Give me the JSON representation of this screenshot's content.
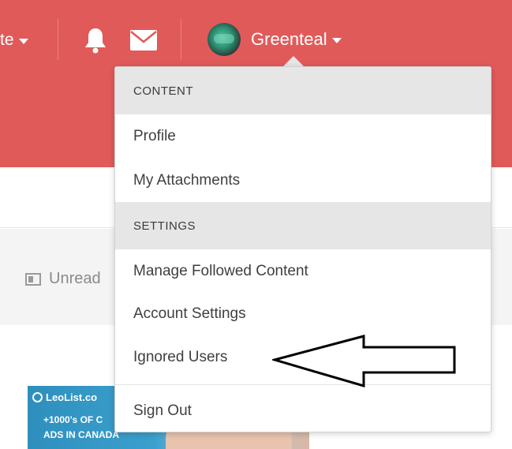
{
  "topbar": {
    "create_label": "te",
    "username": "Greenteal",
    "icons": [
      "bell-icon",
      "mail-icon",
      "avatar"
    ],
    "color": "#e15a5a"
  },
  "content": {
    "unread_label": "Unread",
    "ad": {
      "brand": "LeoList.co",
      "line1": "+1000's OF C",
      "line2": "ADS IN CANADA"
    }
  },
  "dropdown": {
    "sections": [
      {
        "header": "CONTENT",
        "items": [
          "Profile",
          "My Attachments"
        ]
      },
      {
        "header": "SETTINGS",
        "items": [
          "Manage Followed Content",
          "Account Settings",
          "Ignored Users"
        ]
      }
    ],
    "footer": "Sign Out"
  },
  "annotation": {
    "type": "arrow",
    "points_to": "Ignored Users"
  }
}
